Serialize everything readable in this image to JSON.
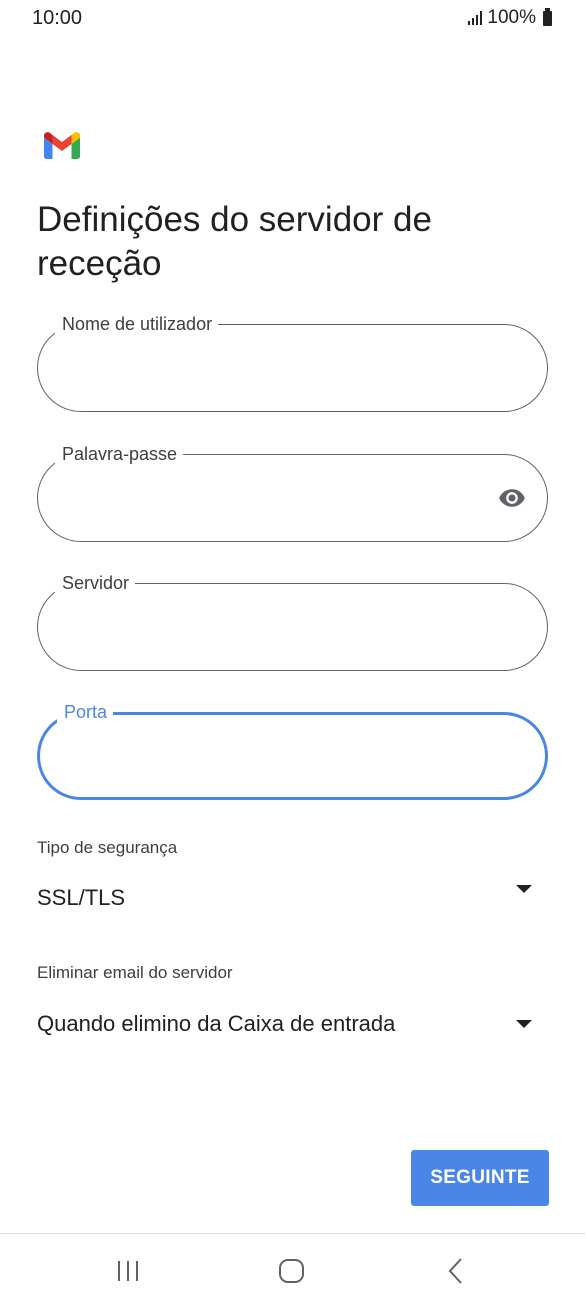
{
  "status_bar": {
    "time": "10:00",
    "battery": "100%"
  },
  "page": {
    "title": "Definições do servidor de receção"
  },
  "fields": {
    "username": {
      "label": "Nome de utilizador",
      "value": ""
    },
    "password": {
      "label": "Palavra-passe",
      "value": ""
    },
    "server": {
      "label": "Servidor",
      "value": ""
    },
    "port": {
      "label": "Porta",
      "value": ""
    }
  },
  "security": {
    "label": "Tipo de segurança",
    "value": "SSL/TLS"
  },
  "delete_email": {
    "label": "Eliminar email do servidor",
    "value": "Quando elimino da Caixa de entrada"
  },
  "actions": {
    "next_label": "SEGUINTE"
  },
  "colors": {
    "accent": "#4a86e8",
    "text": "#202124",
    "outline": "#5f6368"
  },
  "icons": [
    "signal-icon",
    "battery-icon",
    "gmail-logo",
    "eye-icon",
    "dropdown-arrow-icon",
    "recents-icon",
    "home-icon",
    "back-icon"
  ]
}
